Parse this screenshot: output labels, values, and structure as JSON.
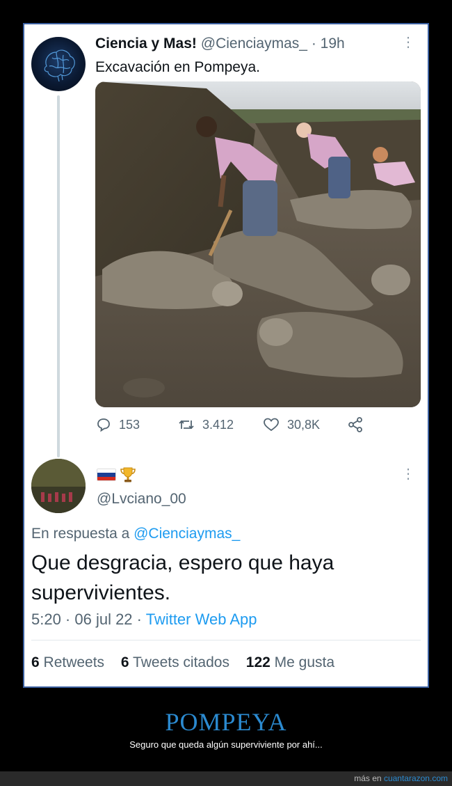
{
  "tweet": {
    "name": "Ciencia y Mas!",
    "handle": "@Cienciaymas_",
    "separator": "·",
    "time": "19h",
    "more": "⋮",
    "text": "Excavación en Pompeya.",
    "replies": "153",
    "retweets": "3.412",
    "likes": "30,8K"
  },
  "reply": {
    "flag_colors": [
      "#ffffff",
      "#1c3f95",
      "#d52b1e"
    ],
    "trophy_icon": "trophy-icon",
    "handle": "@Lvciano_00",
    "more": "⋮",
    "in_reply_prefix": "En respuesta a ",
    "in_reply_to": "@Cienciaymas_",
    "text": "Que desgracia, espero que haya supervivientes.",
    "time": "5:20 · 06 jul 22 · ",
    "source": "Twitter Web App",
    "retweets_count": "6",
    "retweets_label": " Retweets",
    "quotes_count": "6",
    "quotes_label": " Tweets citados",
    "likes_count": "122",
    "likes_label": " Me gusta"
  },
  "caption": {
    "title": "POMPEYA",
    "subtitle": "Seguro que queda algún superviviente por ahí..."
  },
  "footer": {
    "prefix": "más en ",
    "site": "cuantarazon.com"
  },
  "colors": {
    "accent": "#1d9bf0",
    "frame_border": "#3a5fa0",
    "title": "#2b8ad0"
  }
}
